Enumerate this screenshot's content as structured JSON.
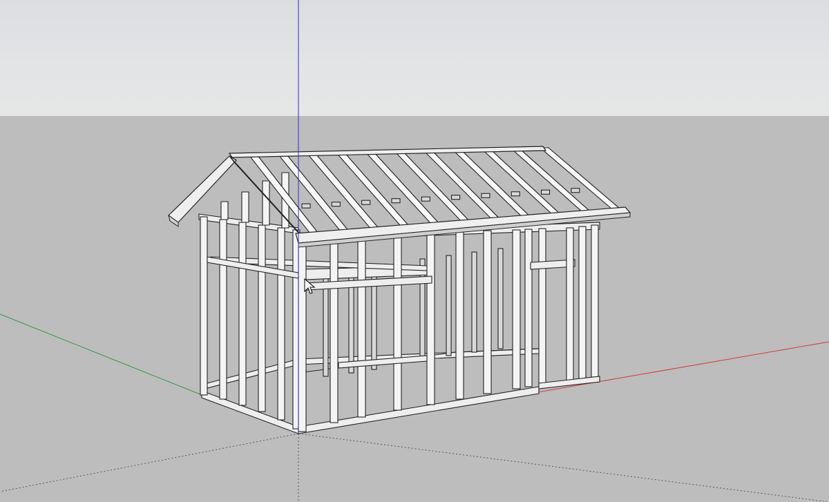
{
  "viewport": {
    "sky_color": "#e3e4e6",
    "ground_color": "#bdbdbd",
    "axes": {
      "blue_axis_color": "#2a2ad6",
      "red_axis_color": "#d23a3a",
      "green_axis_color": "#2f9a3a",
      "dotted_axis_color": "#555555"
    }
  },
  "model": {
    "roof_rafter_count": 11,
    "front_wall_stud_count": 8,
    "left_wall_stud_count": 6
  },
  "cursor": {
    "icon": "arrow-cursor-icon"
  }
}
